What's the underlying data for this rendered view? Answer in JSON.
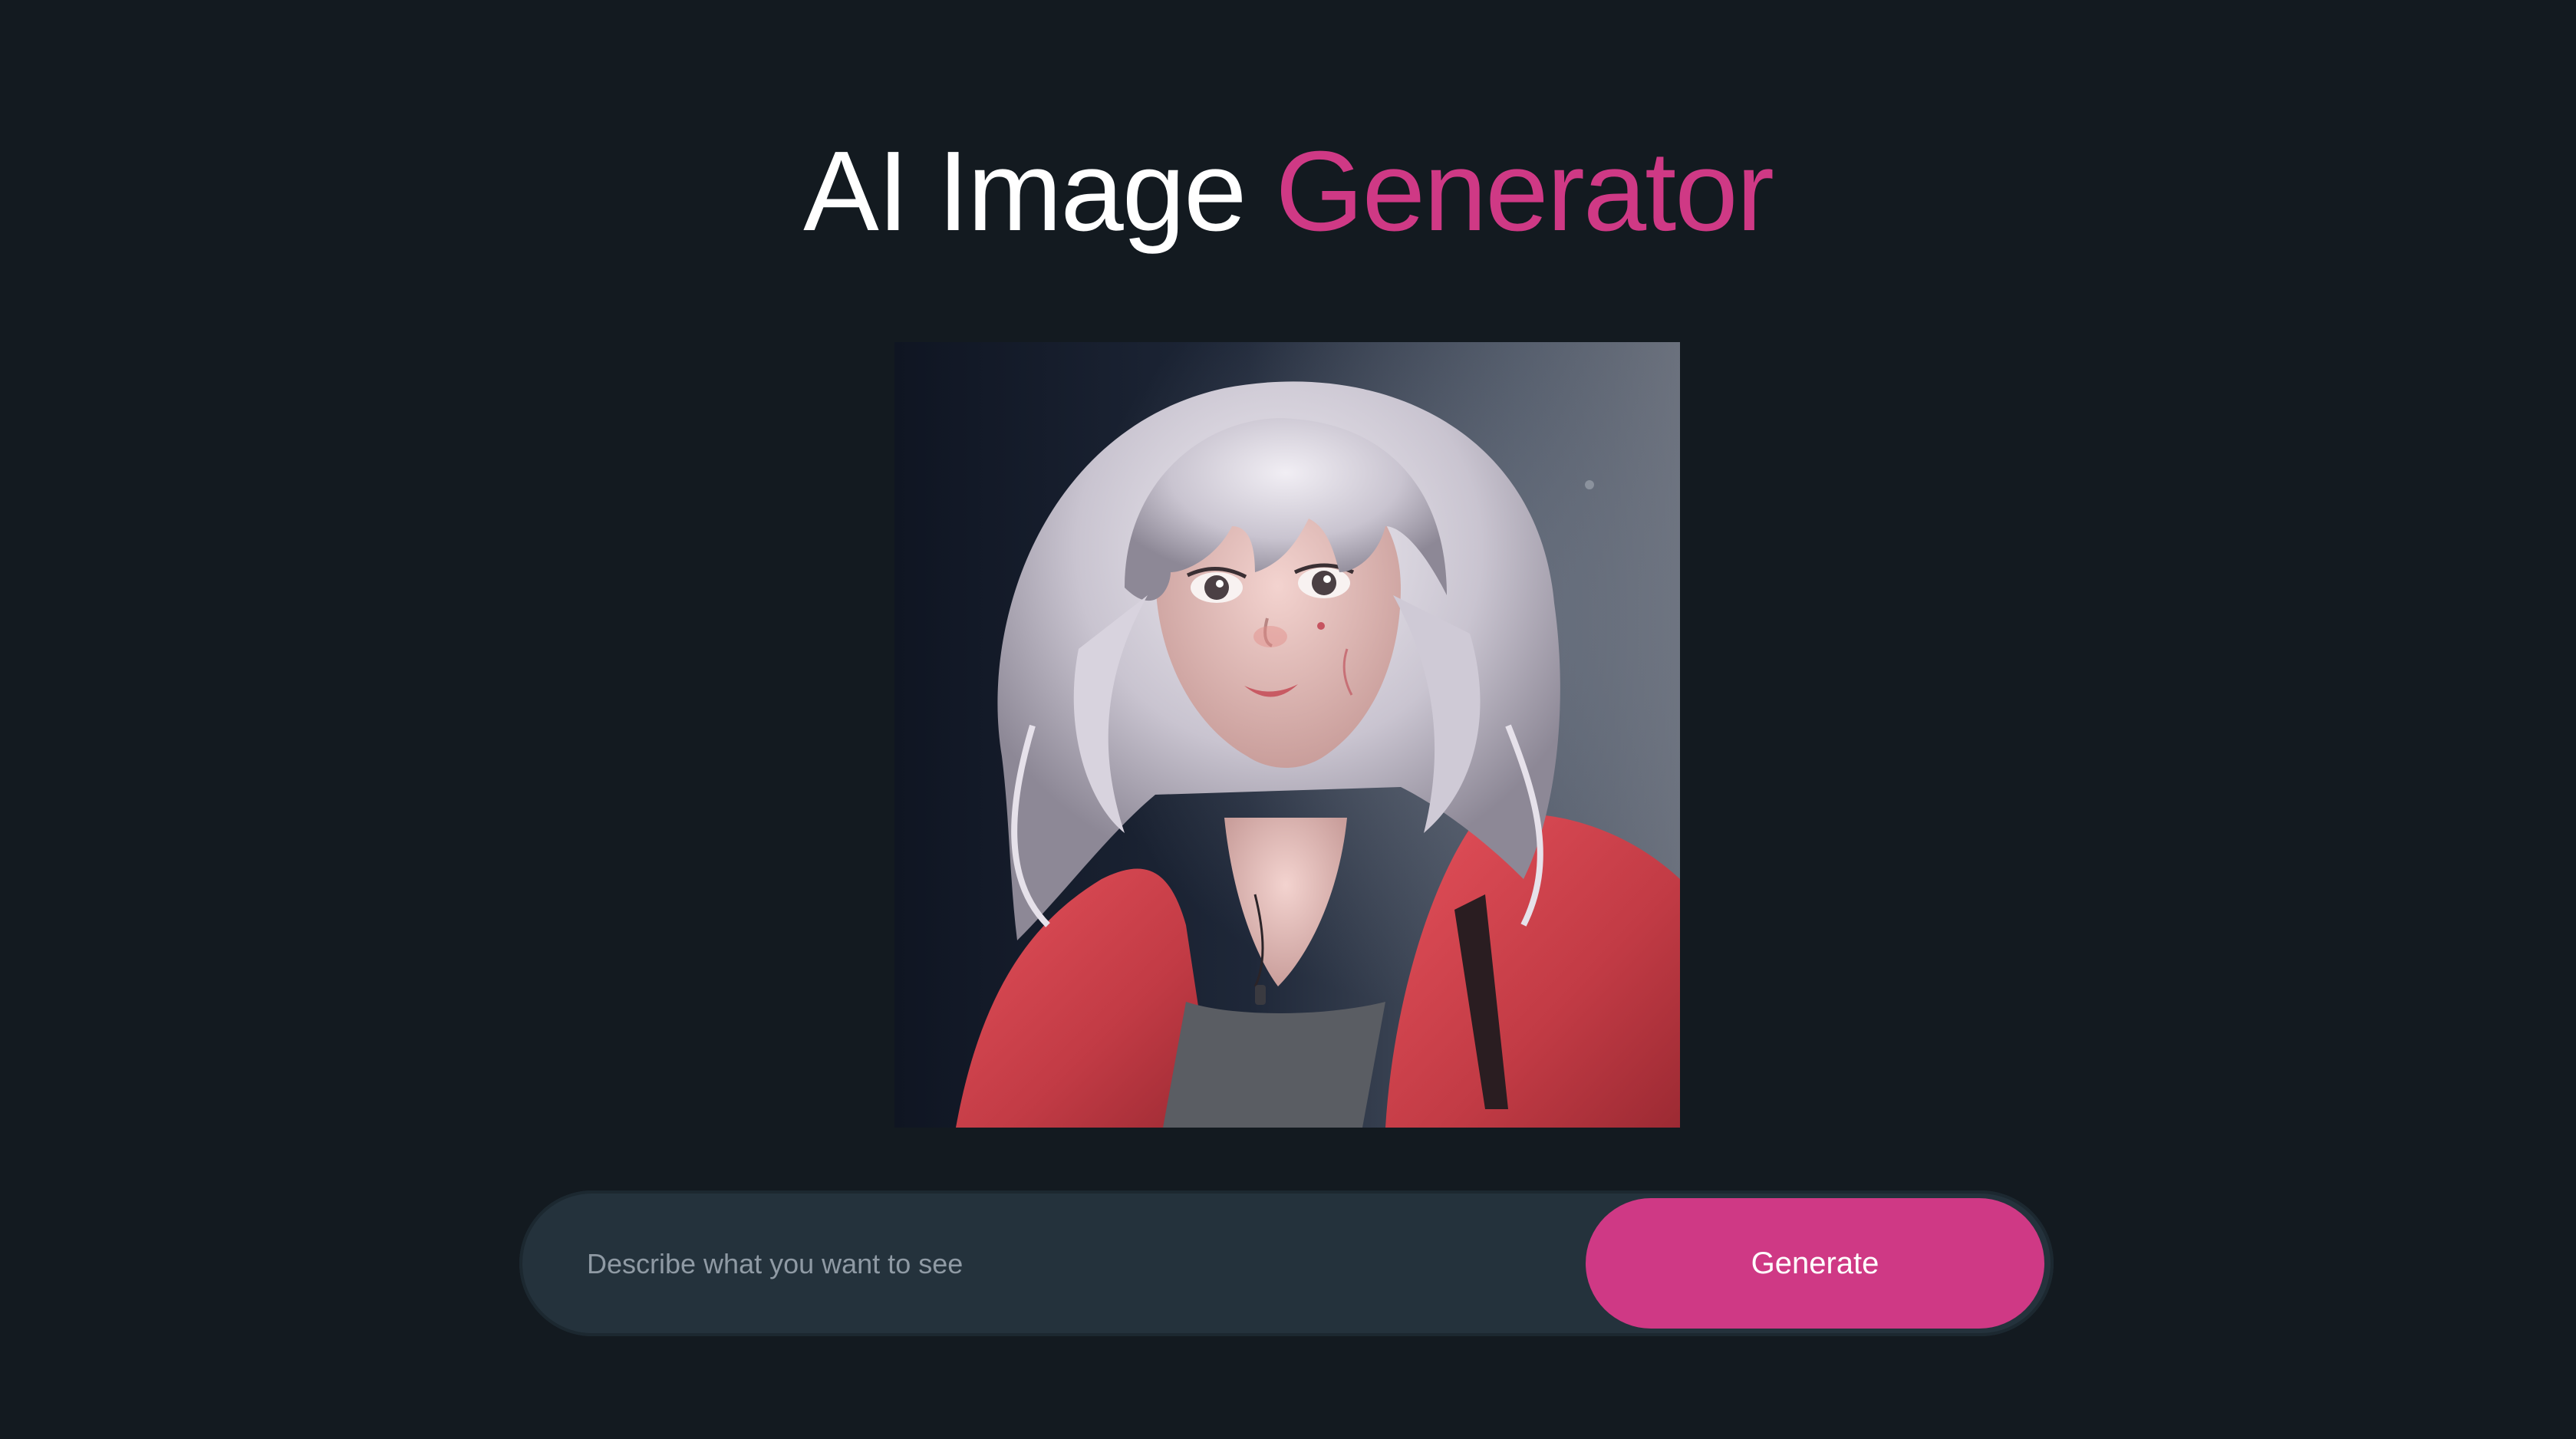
{
  "header": {
    "title_main": "AI Image ",
    "title_accent": "Generator"
  },
  "image": {
    "alt": "Generated image"
  },
  "prompt": {
    "placeholder": "Describe what you want to see",
    "value": ""
  },
  "actions": {
    "generate_label": "Generate"
  },
  "colors": {
    "background": "#131a20",
    "accent": "#cf3985",
    "input_background": "#24323c"
  }
}
